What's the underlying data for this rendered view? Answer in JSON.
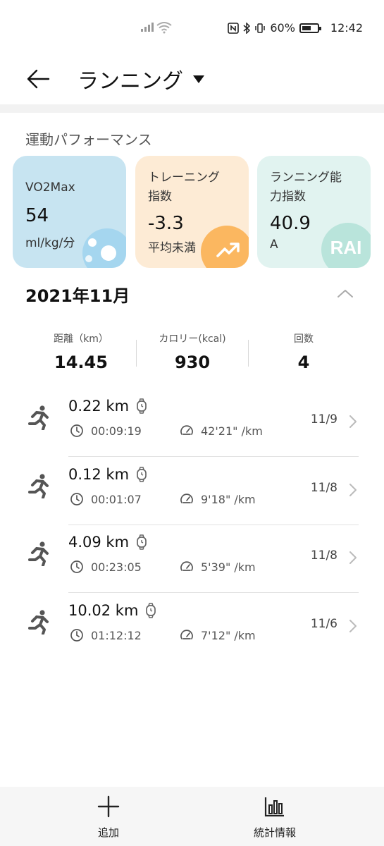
{
  "status_bar": {
    "battery": "60%",
    "time": "12:42"
  },
  "header": {
    "title": "ランニング"
  },
  "performance": {
    "section_title": "運動パフォーマンス",
    "cards": [
      {
        "label": "VO2Max",
        "value": "54",
        "unit": "ml/kg/分",
        "icon": "bubbles-icon",
        "color": "#c7e4f1"
      },
      {
        "label_line1": "トレーニング",
        "label_line2": "指数",
        "value": "-3.3",
        "unit": "平均未満",
        "icon": "trend-up-icon",
        "color": "#fdebd5"
      },
      {
        "label_line1": "ランニング能",
        "label_line2": "力指数",
        "value": "40.9",
        "unit": "A",
        "badge": "RAI",
        "color": "#e1f3f0"
      }
    ]
  },
  "month": {
    "label": "2021年11月"
  },
  "summary": {
    "distance": {
      "label": "距離（km）",
      "value": "14.45"
    },
    "calories": {
      "label": "カロリー(kcal)",
      "value": "930"
    },
    "count": {
      "label": "回数",
      "value": "4"
    }
  },
  "records": [
    {
      "distance": "0.22 km",
      "duration": "00:09:19",
      "pace": "42'21\" /km",
      "date": "11/9"
    },
    {
      "distance": "0.12 km",
      "duration": "00:01:07",
      "pace": "9'18\" /km",
      "date": "11/8"
    },
    {
      "distance": "4.09 km",
      "duration": "00:23:05",
      "pace": "5'39\" /km",
      "date": "11/8"
    },
    {
      "distance": "10.02 km",
      "duration": "01:12:12",
      "pace": "7'12\" /km",
      "date": "11/6"
    }
  ],
  "bottom_bar": {
    "add_label": "追加",
    "stats_label": "統計情報"
  },
  "colors": {
    "vo2_card": "#c7e4f1",
    "training_card": "#fdebd5",
    "rai_card": "#e1f3f0",
    "training_icon": "#f9b45a",
    "vo2_icon": "#8dcbea"
  }
}
